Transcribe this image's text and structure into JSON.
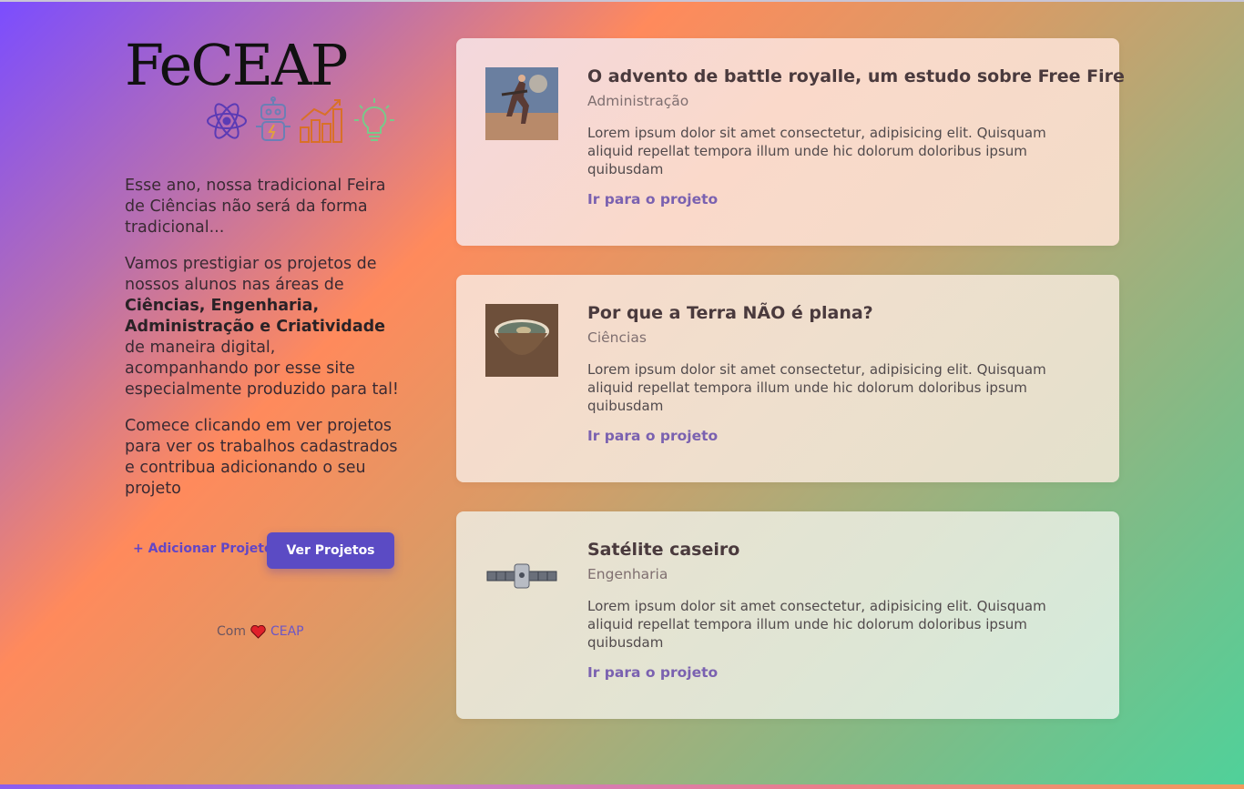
{
  "brand": {
    "logo_text": "FeCEAP",
    "icons": [
      "atom-icon",
      "robot-icon",
      "bar-chart-icon",
      "lightbulb-icon"
    ]
  },
  "intro": {
    "p1": "Esse ano, nossa tradicional Feira de Ciências não será da forma tradicional...",
    "p2_before": "Vamos prestigiar os projetos de nossos alunos nas áreas de ",
    "p2_strong": "Ciências, Engenharia, Administração e Criatividade",
    "p2_after": " de maneira digital, acompanhando por esse site especialmente produzido para tal!",
    "p3": "Comece clicando em ver projetos para ver os trabalhos cadastrados e contribua adicionando o seu projeto"
  },
  "actions": {
    "add_label": "+ Adicionar Projeto",
    "view_label": "Ver Projetos"
  },
  "footer": {
    "prefix": "Com",
    "suffix": "CEAP"
  },
  "projects": [
    {
      "title": "O advento de battle royalle, um estudo sobre Free Fire",
      "category": "Administração",
      "description": "Lorem ipsum dolor sit amet consectetur, adipisicing elit. Quisquam aliquid repellat tempora illum unde hic dolorum doloribus ipsum quibusdam",
      "link": "Ir para o projeto"
    },
    {
      "title": "Por que a Terra NÃO é plana?",
      "category": "Ciências",
      "description": "Lorem ipsum dolor sit amet consectetur, adipisicing elit. Quisquam aliquid repellat tempora illum unde hic dolorum doloribus ipsum quibusdam",
      "link": "Ir para o projeto"
    },
    {
      "title": "Satélite caseiro",
      "category": "Engenharia",
      "description": "Lorem ipsum dolor sit amet consectetur, adipisicing elit. Quisquam aliquid repellat tempora illum unde hic dolorum doloribus ipsum quibusdam",
      "link": "Ir para o projeto"
    }
  ],
  "colors": {
    "accent": "#5b4bc4",
    "link": "#7a61b0",
    "heart": "#e0202a"
  }
}
